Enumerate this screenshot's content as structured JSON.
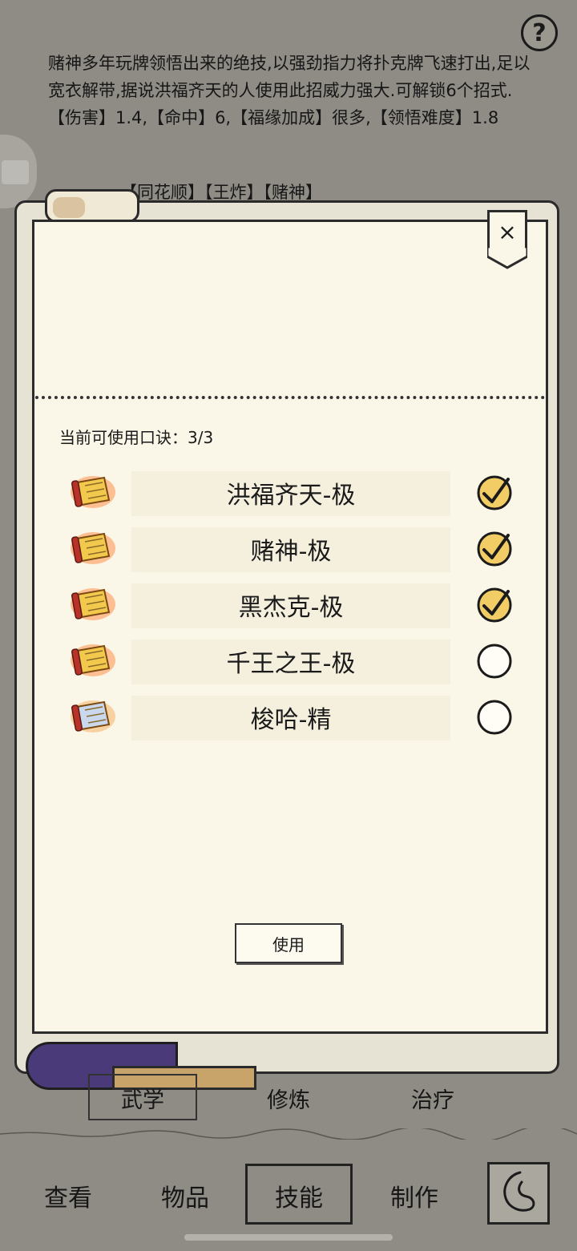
{
  "description": {
    "text": "赌神多年玩牌领悟出来的绝技,以强劲指力将扑克牌飞速打出,足以宽衣解带,据说洪福齐天的人使用此招威力强大.可解锁6个招式.",
    "stats": "【伤害】1.4,【命中】6,【福缘加成】很多,【领悟难度】1.8",
    "tags": "【同花顺】【王炸】【赌神】"
  },
  "help": {
    "label": "?"
  },
  "dialog": {
    "close_label": "×",
    "count_label": "当前可使用口诀：3/3",
    "skills": [
      {
        "name": "洪福齐天-极",
        "icon": "gold-scroll-icon",
        "checked": true
      },
      {
        "name": "赌神-极",
        "icon": "gold-scroll-icon",
        "checked": true
      },
      {
        "name": "黑杰克-极",
        "icon": "gold-scroll-icon",
        "checked": true
      },
      {
        "name": "千王之王-极",
        "icon": "gold-scroll-icon",
        "checked": false
      },
      {
        "name": "梭哈-精",
        "icon": "blue-scroll-icon",
        "checked": false
      }
    ],
    "use_button": "使用"
  },
  "subtabs": {
    "wuxue": "武学",
    "xiulian": "修炼",
    "zhiliao": "治疗"
  },
  "nav": {
    "view": "查看",
    "items": "物品",
    "skills": "技能",
    "craft": "制作"
  },
  "colors": {
    "panel": "#fbf7e8",
    "background": "#8f8c86",
    "gold_scroll": "#f2c94c",
    "blue_scroll": "#c9d8ec"
  }
}
